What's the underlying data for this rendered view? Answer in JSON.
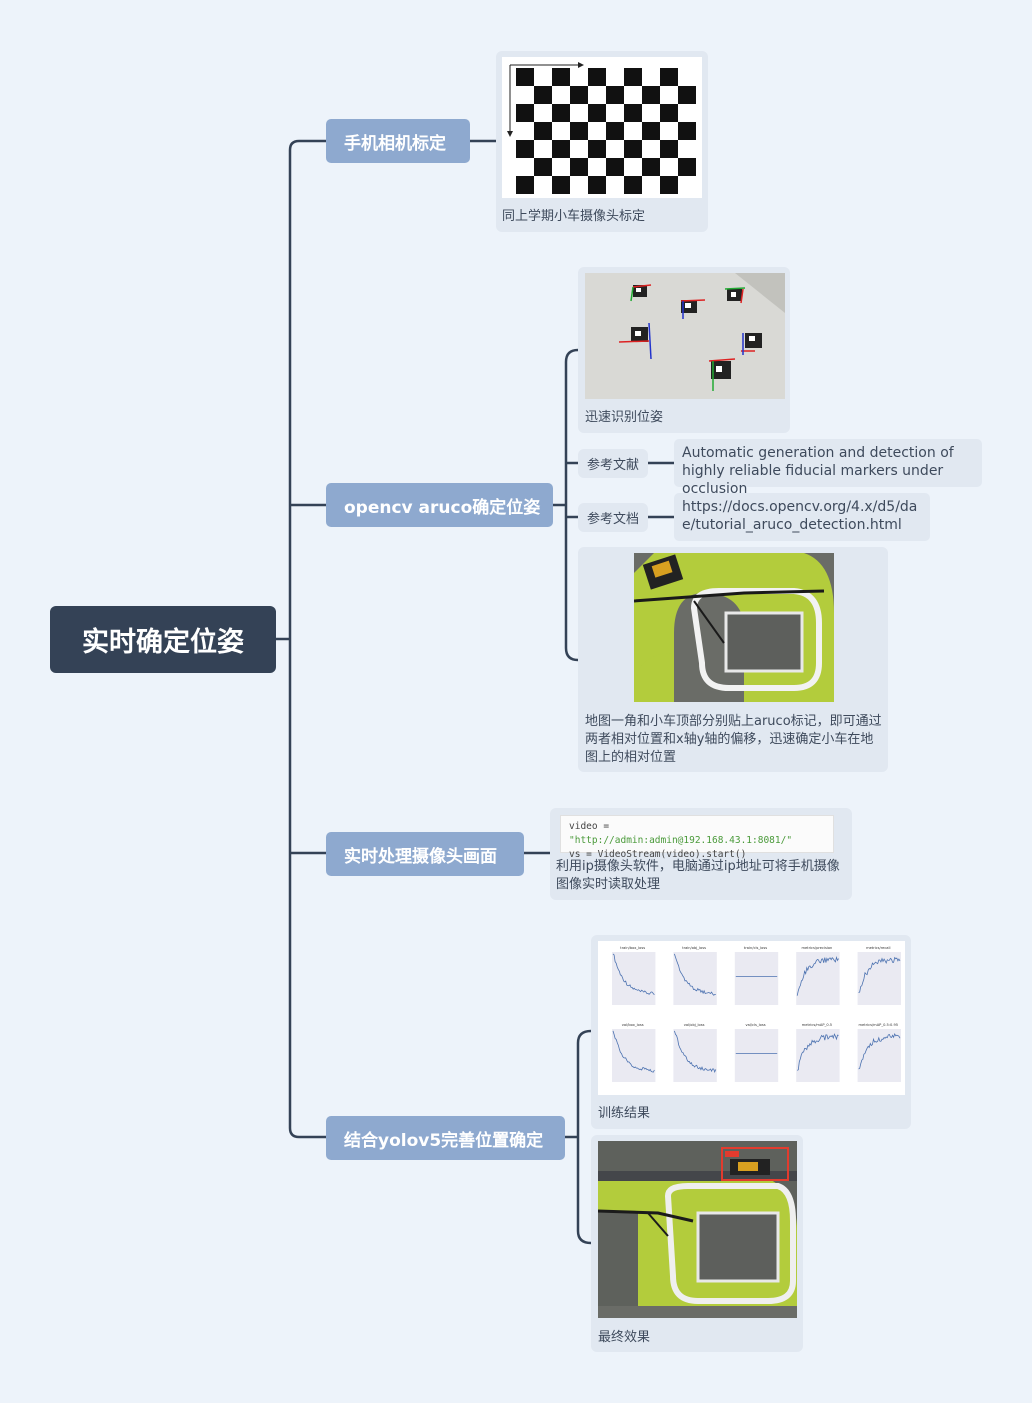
{
  "root": {
    "title": "实时确定位姿"
  },
  "branches": {
    "calibration": {
      "title": "手机相机标定",
      "caption": "同上学期小车摄像头标定"
    },
    "aruco": {
      "title": "opencv aruco确定位姿",
      "image1_caption": "迅速识别位姿",
      "ref1_label": "参考文献",
      "ref1_text": "Automatic generation and detection of highly reliable fiducial markers under occlusion",
      "ref2_label": "参考文档",
      "ref2_text": "https://docs.opencv.org/4.x/d5/dae/tutorial_aruco_detection.html",
      "image2_caption": "地图一角和小车顶部分别贴上aruco标记，即可通过两者相对位置和x轴y轴的偏移，迅速确定小车在地图上的相对位置"
    },
    "camera": {
      "title": "实时处理摄像头画面",
      "code_line1_pre": "video = ",
      "code_line1_str": "\"http://admin:admin@192.168.43.1:8081/\"",
      "code_line2": "vs = VideoStream(video).start()",
      "caption": "利用ip摄像头软件，电脑通过ip地址可将手机摄像图像实时读取处理"
    },
    "yolo": {
      "title": "结合yolov5完善位置确定",
      "image1_caption": "训练结果",
      "image2_caption": "最终效果",
      "plot_titles": [
        "train/box_loss",
        "train/obj_loss",
        "train/cls_loss",
        "metrics/precision",
        "metrics/recall",
        "val/box_loss",
        "val/obj_loss",
        "val/cls_loss",
        "metrics/mAP_0.5",
        "metrics/mAP_0.5:0.95"
      ]
    }
  },
  "colors": {
    "root_bg": "#344256",
    "topic_bg": "#8ea9cf",
    "card_bg": "#e1e8f1",
    "connector": "#344256",
    "page_bg": "#edf3fa"
  }
}
